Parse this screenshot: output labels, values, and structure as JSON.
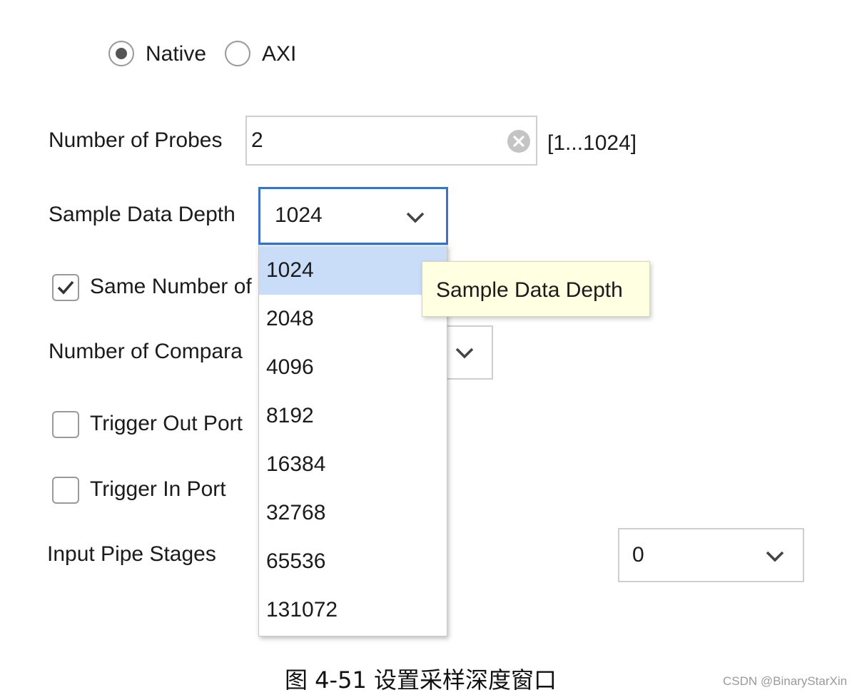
{
  "interface": {
    "options": [
      {
        "label": "Native",
        "selected": true
      },
      {
        "label": "AXI",
        "selected": false
      }
    ]
  },
  "probes": {
    "label": "Number of Probes",
    "value": "2",
    "range": "[1...1024]"
  },
  "depth": {
    "label": "Sample Data Depth",
    "value": "1024",
    "options": [
      "1024",
      "2048",
      "4096",
      "8192",
      "16384",
      "32768",
      "65536",
      "131072"
    ],
    "selected_option": "1024",
    "tooltip": "Sample Data Depth"
  },
  "same_number": {
    "label": "Same Number of",
    "checked": true
  },
  "comparators": {
    "label": "Number of Compara"
  },
  "trigger_out": {
    "label": "Trigger Out Port",
    "checked": false
  },
  "trigger_in": {
    "label": "Trigger In Port",
    "checked": false
  },
  "pipe": {
    "label": "Input Pipe Stages",
    "value": "0"
  },
  "caption": "图 4-51 设置采样深度窗口",
  "watermark": "CSDN @BinaryStarXin",
  "colors": {
    "focus_border": "#3b73c7",
    "selected_option_bg": "#c9dcf8",
    "tooltip_bg": "#ffffe1"
  }
}
